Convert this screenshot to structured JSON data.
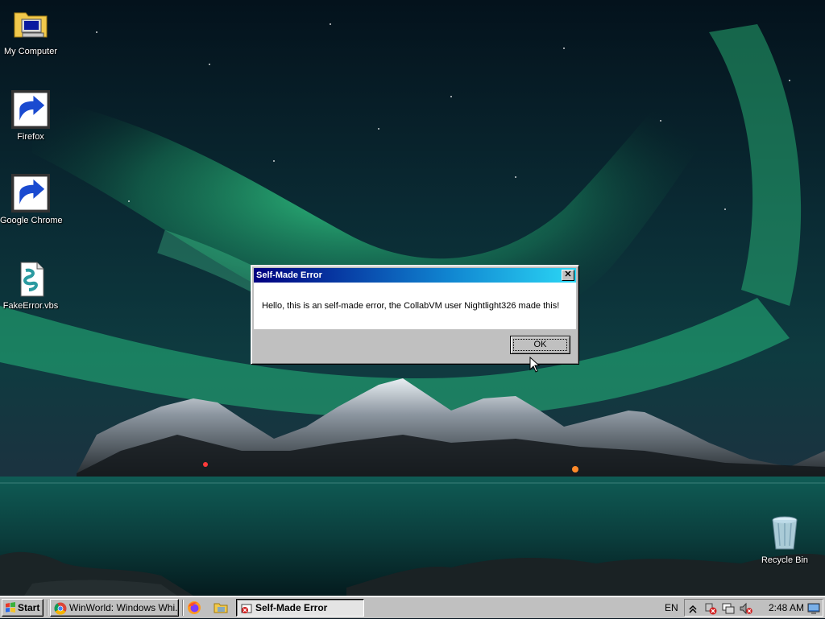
{
  "desktop": {
    "icons": [
      {
        "label": "My Computer"
      },
      {
        "label": "Firefox"
      },
      {
        "label": "Google Chrome"
      },
      {
        "label": "FakeError.vbs"
      },
      {
        "label": "Recycle Bin"
      }
    ]
  },
  "dialog": {
    "title": "Self-Made Error",
    "close_glyph": "✕",
    "message": "Hello, this is an self-made error, the CollabVM user Nightlight326 made this!",
    "ok_label": "OK"
  },
  "taskbar": {
    "start_label": "Start",
    "tasks": [
      {
        "label": "WinWorld: Windows Whi...",
        "icon": "chrome-icon"
      },
      {
        "label": "Self-Made Error",
        "icon": "error-app-icon"
      }
    ],
    "quick_launch": [
      "firefox-icon",
      "folder-icon"
    ],
    "language": "EN",
    "clock": "2:48 AM",
    "tray_icons": [
      "show-hidden-icons-icon",
      "network-error-icon",
      "display-icon",
      "volume-muted-icon",
      "desktop-icon"
    ]
  },
  "colors": {
    "title_gradient_start": "#000080",
    "title_gradient_end": "#2bd7f5",
    "chrome_face": "#c0c0c0"
  }
}
